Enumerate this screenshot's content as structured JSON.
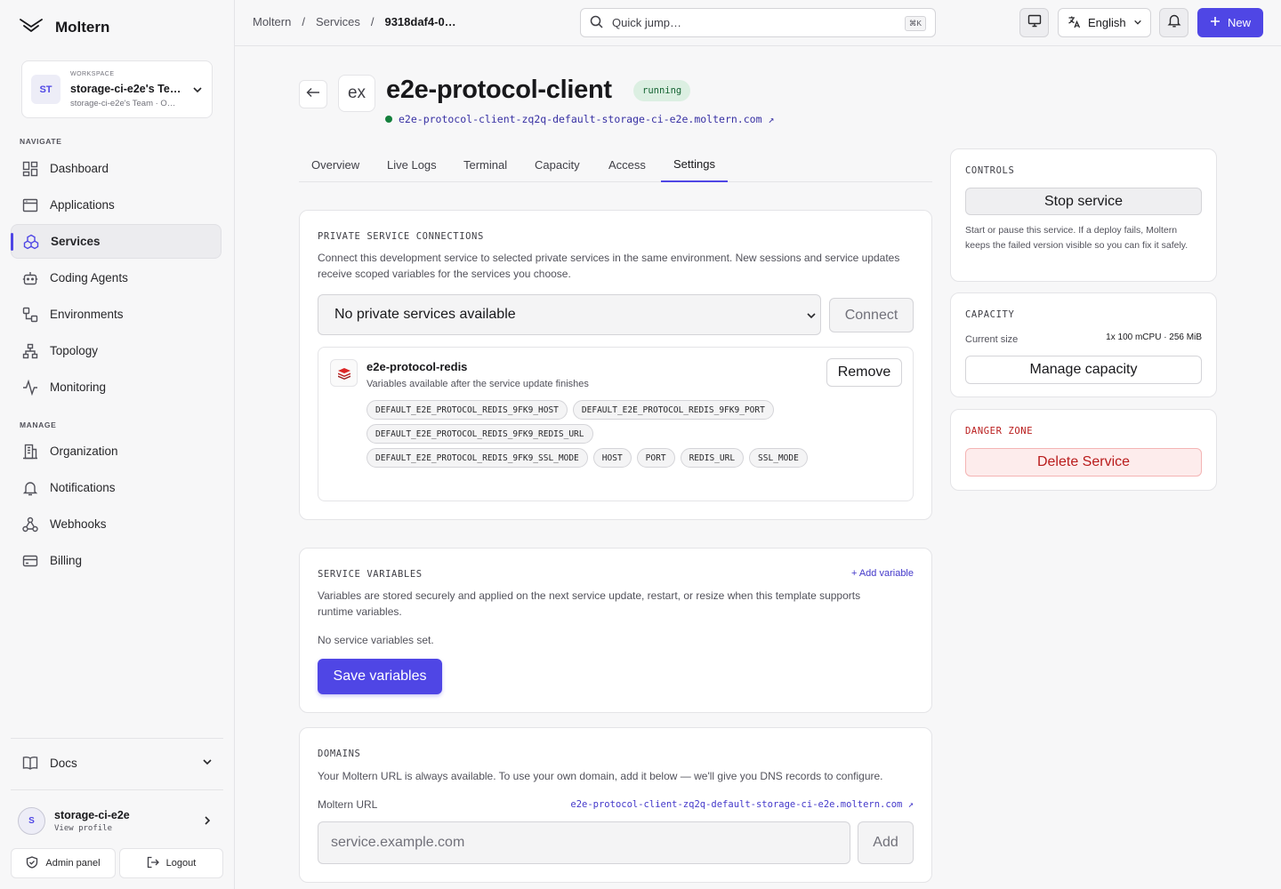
{
  "brand": {
    "name": "Moltern"
  },
  "workspace": {
    "kicker": "WORKSPACE",
    "avatar": "ST",
    "name": "storage-ci-e2e's Te…",
    "sub": "storage-ci-e2e's Team · O…"
  },
  "nav": {
    "navigate_label": "NAVIGATE",
    "manage_label": "MANAGE",
    "items": [
      {
        "label": "Dashboard",
        "icon": "dashboard-icon"
      },
      {
        "label": "Applications",
        "icon": "applications-icon"
      },
      {
        "label": "Services",
        "icon": "services-icon",
        "active": true
      },
      {
        "label": "Coding Agents",
        "icon": "robot-icon"
      },
      {
        "label": "Environments",
        "icon": "environments-icon"
      },
      {
        "label": "Topology",
        "icon": "topology-icon"
      },
      {
        "label": "Monitoring",
        "icon": "activity-icon"
      },
      {
        "label": "Organization",
        "icon": "building-icon"
      },
      {
        "label": "Notifications",
        "icon": "bell-icon"
      },
      {
        "label": "Webhooks",
        "icon": "webhook-icon"
      },
      {
        "label": "Billing",
        "icon": "credit-card-icon"
      }
    ],
    "docs": "Docs"
  },
  "profile": {
    "avatar": "S",
    "name": "storage-ci-e2e",
    "sub": "View profile"
  },
  "footer": {
    "admin": "Admin panel",
    "logout": "Logout"
  },
  "topbar": {
    "crumbs": [
      "Moltern",
      "/",
      "Services",
      "/",
      "9318daf4-0…"
    ],
    "search_placeholder": "Quick jump…",
    "shortcut": "⌘K",
    "language": "English",
    "new_label": "New"
  },
  "service": {
    "logo": "ex",
    "title": "e2e-protocol-client",
    "status": "running",
    "url": "e2e-protocol-client-zq2q-default-storage-ci-e2e.moltern.com ↗"
  },
  "tabs": [
    "Overview",
    "Live Logs",
    "Terminal",
    "Capacity",
    "Access",
    "Settings"
  ],
  "private_connections": {
    "heading": "PRIVATE SERVICE CONNECTIONS",
    "desc": "Connect this development service to selected private services in the same environment. New sessions and service updates receive scoped variables for the services you choose.",
    "select_value": "No private services available",
    "connect_label": "Connect",
    "connection": {
      "name": "e2e-protocol-redis",
      "sub": "Variables available after the service update finishes",
      "remove_label": "Remove",
      "variables": [
        "DEFAULT_E2E_PROTOCOL_REDIS_9FK9_HOST",
        "DEFAULT_E2E_PROTOCOL_REDIS_9FK9_PORT",
        "DEFAULT_E2E_PROTOCOL_REDIS_9FK9_REDIS_URL",
        "DEFAULT_E2E_PROTOCOL_REDIS_9FK9_SSL_MODE",
        "HOST",
        "PORT",
        "REDIS_URL",
        "SSL_MODE"
      ]
    }
  },
  "service_variables": {
    "heading": "SERVICE VARIABLES",
    "add_label": "+ Add variable",
    "desc": "Variables are stored securely and applied on the next service update, restart, or resize when this template supports runtime variables.",
    "empty": "No service variables set.",
    "save_label": "Save variables"
  },
  "domains": {
    "heading": "DOMAINS",
    "desc": "Your Moltern URL is always available. To use your own domain, add it below — we'll give you DNS records to configure.",
    "url_label": "Moltern URL",
    "url_value": "e2e-protocol-client-zq2q-default-storage-ci-e2e.moltern.com ↗",
    "input_placeholder": "service.example.com",
    "add_label": "Add"
  },
  "controls": {
    "heading": "CONTROLS",
    "stop_label": "Stop service",
    "desc": "Start or pause this service. If a deploy fails, Moltern keeps the failed version visible so you can fix it safely."
  },
  "capacity": {
    "heading": "CAPACITY",
    "label": "Current size",
    "value": "1x 100 mCPU · 256 MiB",
    "manage_label": "Manage capacity"
  },
  "danger": {
    "heading": "DANGER ZONE",
    "delete_label": "Delete Service"
  },
  "colors": {
    "accent": "#4f46e5",
    "status_bg": "#dcefe2",
    "status_text": "#166534",
    "danger": "#b91c1c",
    "danger_bg": "#fdecec"
  }
}
